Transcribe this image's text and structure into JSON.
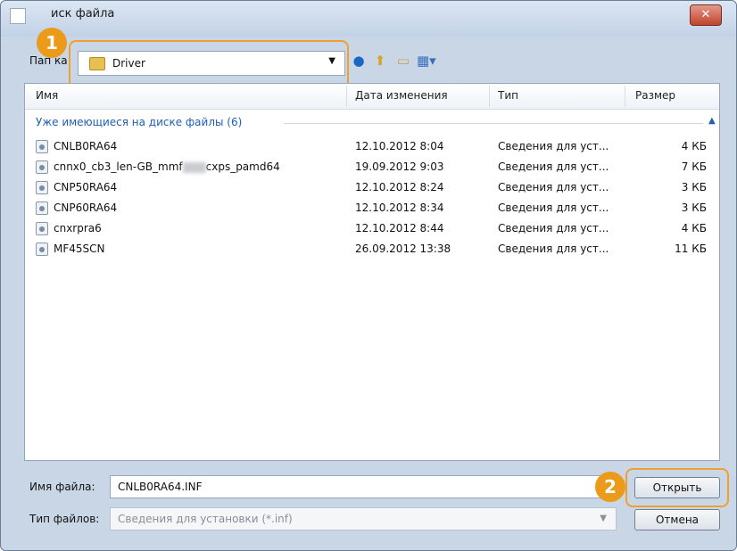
{
  "window": {
    "title": "Поиск файла",
    "title_visible": "иск файла",
    "close_label": "✕"
  },
  "lookin": {
    "label": "Папка:",
    "label_visible": "Пап ка:",
    "current": "Driver"
  },
  "toolbar": {
    "back_icon": "back-icon",
    "up_icon": "up-folder-icon",
    "new_folder_icon": "new-folder-icon",
    "views_icon": "views-menu-icon"
  },
  "columns": {
    "name": "Имя",
    "date": "Дата изменения",
    "type": "Тип",
    "size": "Размер"
  },
  "group": {
    "label": "Уже имеющиеся на диске файлы (6)"
  },
  "files": [
    {
      "name": "CNLB0RA64",
      "date": "12.10.2012 8:04",
      "type": "Сведения для уст...",
      "size": "4 КБ"
    },
    {
      "name_prefix": "cnnx0_cb3_len-GB_mmf",
      "name_suffix": "cxps_pamd64",
      "date": "19.09.2012 9:03",
      "type": "Сведения для уст...",
      "size": "7 КБ"
    },
    {
      "name": "CNP50RA64",
      "date": "12.10.2012 8:24",
      "type": "Сведения для уст...",
      "size": "3 КБ"
    },
    {
      "name": "CNP60RA64",
      "date": "12.10.2012 8:34",
      "type": "Сведения для уст...",
      "size": "3 КБ"
    },
    {
      "name": "cnxrpra6",
      "date": "12.10.2012 8:44",
      "type": "Сведения для уст...",
      "size": "4 КБ"
    },
    {
      "name": "MF45SCN",
      "date": "26.09.2012 13:38",
      "type": "Сведения для уст...",
      "size": "11 КБ"
    }
  ],
  "filename": {
    "label": "Имя файла:",
    "value": "CNLB0RA64.INF"
  },
  "filetype": {
    "label": "Тип файлов:",
    "value": "Сведения для установки (*.inf)"
  },
  "buttons": {
    "open": "Открыть",
    "cancel": "Отмена"
  },
  "callouts": {
    "one": "1",
    "two": "2"
  },
  "colors": {
    "accent": "#f0a030",
    "group_link": "#1e5fb4"
  }
}
